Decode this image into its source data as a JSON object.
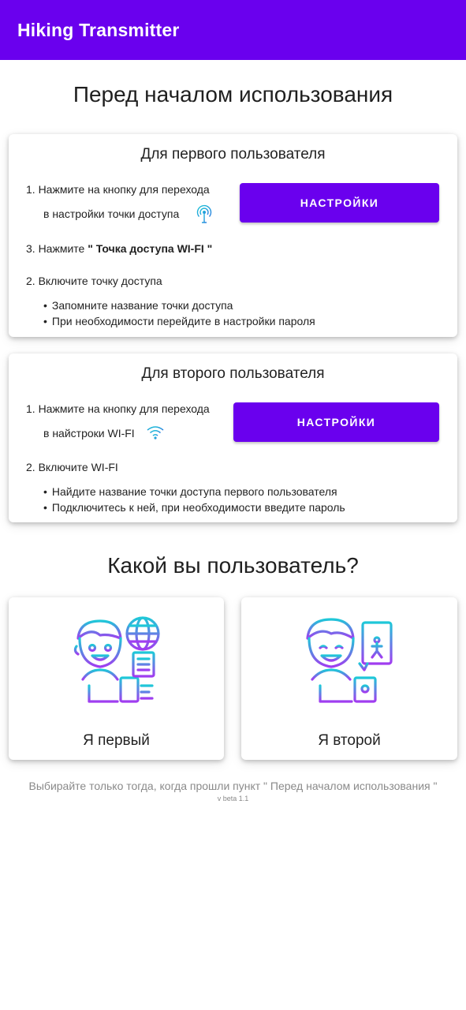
{
  "app": {
    "title": "Hiking Transmitter",
    "accent": "#6a00ee"
  },
  "intro": {
    "heading": "Перед началом использования"
  },
  "first_user": {
    "title": "Для первого пользователя",
    "step1_line1": "1. Нажмите на кнопку для перехода",
    "step1_line2": "в настройки точки доступа",
    "step1_icon": "hotspot-icon",
    "button_label": "НАСТРОЙКИ",
    "step3_prefix": "3. Нажмите ",
    "step3_bold": "\" Точка доступа WI-FI \"",
    "step2": "2. Включите точку доступа",
    "bullets": [
      "Запомните название точки доступа",
      "При необходимости перейдите в настройки пароля"
    ]
  },
  "second_user": {
    "title": "Для второго пользователя",
    "step1_line1": "1. Нажмите на кнопку для перехода",
    "step1_line2": "в найстроки WI-FI",
    "step1_icon": "wifi-icon",
    "button_label": "НАСТРОЙКИ",
    "step2": "2. Включите WI-FI",
    "bullets": [
      "Найдите название точки доступа первого пользователя",
      "Подключитесь к ней, при необходимости введите пароль"
    ]
  },
  "choice": {
    "heading": "Какой вы пользователь?",
    "first_label": "Я первый",
    "second_label": "Я второй",
    "first_icon": "user-globe-document-icon",
    "second_icon": "user-phone-location-icon"
  },
  "footer": {
    "note": "Выбирайте только тогда, когда прошли пункт \" Перед началом использования \"",
    "version": "v beta 1.1"
  }
}
